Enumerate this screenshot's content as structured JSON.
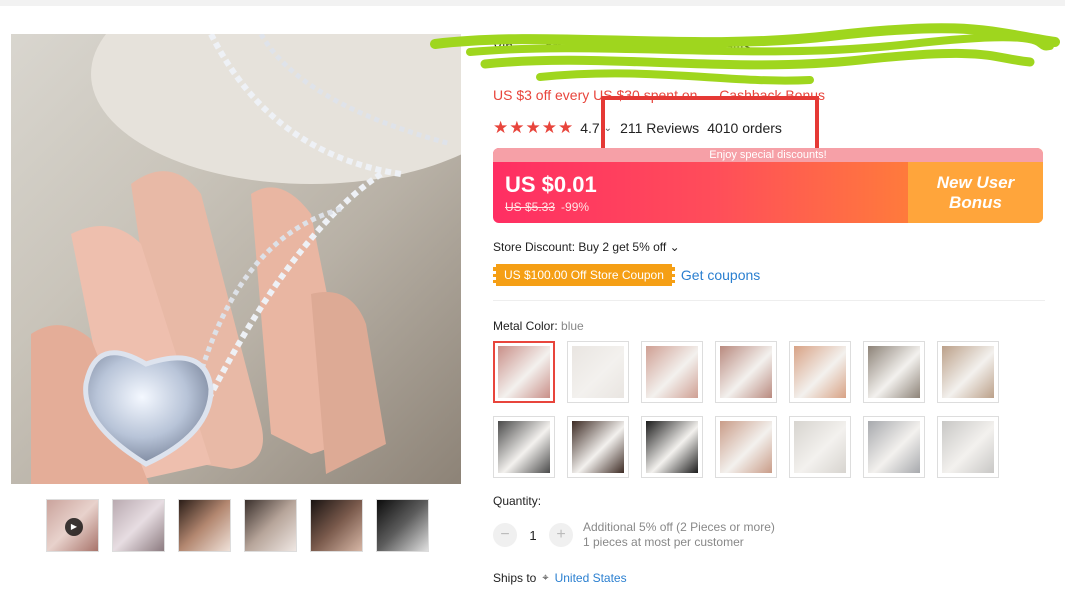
{
  "product": {
    "title_visible": "Vin… …art Pend… …lares … …elry Gifts",
    "promo": "US $3 off every US $30 spent on … Cashback Bonus"
  },
  "rating": {
    "stars": "★★★★★",
    "value": "4.7",
    "reviews": "211 Reviews",
    "orders": "4010 orders"
  },
  "price": {
    "banner_top": "Enjoy special discounts!",
    "current": "US $0.01",
    "original": "US $5.33",
    "discount": "-99%",
    "bonus_line1": "New User",
    "bonus_line2": "Bonus"
  },
  "store": {
    "discount": "Store Discount: Buy 2 get 5% off",
    "coupon": "US $100.00 Off Store Coupon",
    "get_coupons": "Get coupons"
  },
  "variant": {
    "label": "Metal Color: ",
    "selected": "blue",
    "swatches": [
      {
        "color": "#c98f88"
      },
      {
        "color": "#e9e5e1"
      },
      {
        "color": "#cf9f93"
      },
      {
        "color": "#b98a7f"
      },
      {
        "color": "#d8a285"
      },
      {
        "color": "#8d8378"
      },
      {
        "color": "#bba089"
      },
      {
        "color": "#4a4a4a"
      },
      {
        "color": "#3d2b24"
      },
      {
        "color": "#1c1c1c"
      },
      {
        "color": "#c99c88"
      },
      {
        "color": "#d7d4cf"
      },
      {
        "color": "#a7a9ad"
      },
      {
        "color": "#c8c7c5"
      }
    ]
  },
  "quantity": {
    "label": "Quantity:",
    "value": "1",
    "minus": "−",
    "plus": "+",
    "note1": "Additional 5% off (2 Pieces or more)",
    "note2": "1 pieces at most per customer"
  },
  "shipping": {
    "label": "Ships to",
    "country": "United States"
  }
}
